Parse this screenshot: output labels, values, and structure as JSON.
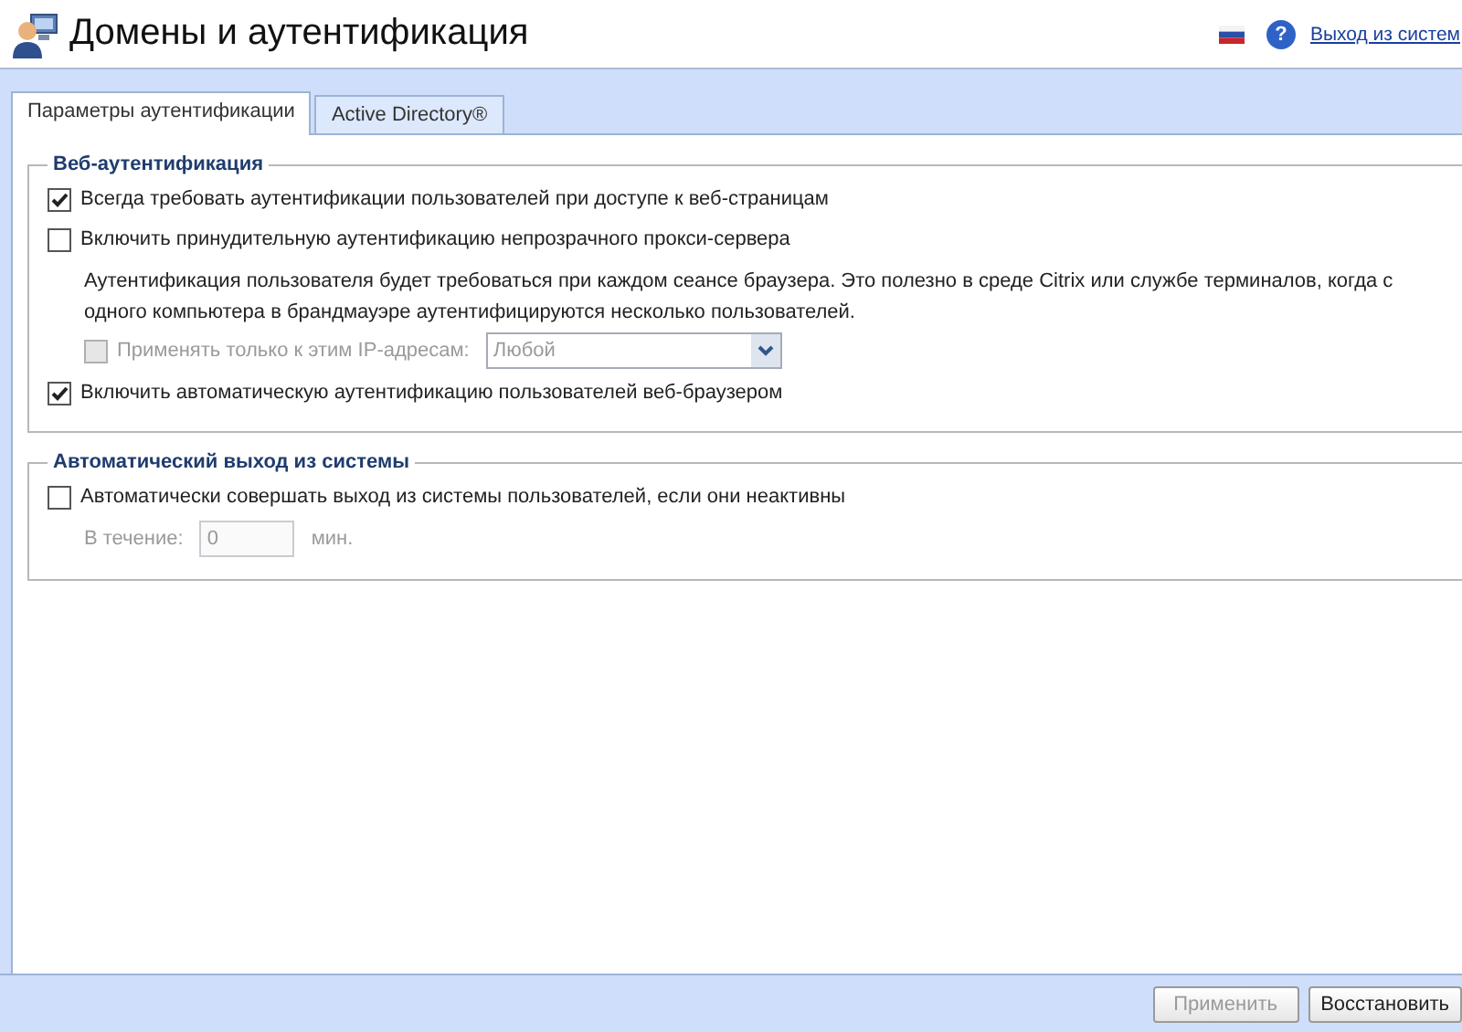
{
  "header": {
    "title": "Домены и аутентификация",
    "help_glyph": "?",
    "logout_link": "Выход из систем"
  },
  "tabs": [
    {
      "label": "Параметры аутентификации",
      "selected": true
    },
    {
      "label": "Active Directory®",
      "selected": false
    }
  ],
  "sections": [
    {
      "title": "Веб-аутентификация",
      "items": [
        {
          "kind": "checkbox",
          "label": "Всегда требовать аутентификации пользователей при доступе к веб-страницам",
          "checked": true,
          "disabled": false
        },
        {
          "kind": "checkbox",
          "label": "Включить принудительную аутентификацию непрозрачного прокси-сервера",
          "checked": false,
          "disabled": false
        },
        {
          "kind": "note",
          "text": "Аутентификация пользователя будет требоваться при каждом сеансе браузера. Это полезно в среде Citrix или службе терминалов, когда с одного компьютера в брандмауэре аутентифицируются несколько пользователей."
        },
        {
          "kind": "select_row",
          "label": "Применять только к этим IP-адресам:",
          "checked": false,
          "disabled": true,
          "value": "Любой"
        },
        {
          "kind": "checkbox",
          "label": "Включить автоматическую аутентификацию пользователей веб-браузером",
          "checked": true,
          "disabled": false
        }
      ]
    },
    {
      "title": "Автоматический выход из системы",
      "items": [
        {
          "kind": "checkbox",
          "label": "Автоматически совершать выход из системы пользователей, если они неактивны",
          "checked": false,
          "disabled": false
        },
        {
          "kind": "input_row",
          "label": "В течение:",
          "value": "0",
          "unit": "мин.",
          "disabled": true
        }
      ]
    }
  ],
  "buttons": [
    {
      "label": "Применить",
      "disabled": true
    },
    {
      "label": "Восстановить",
      "disabled": false
    }
  ]
}
